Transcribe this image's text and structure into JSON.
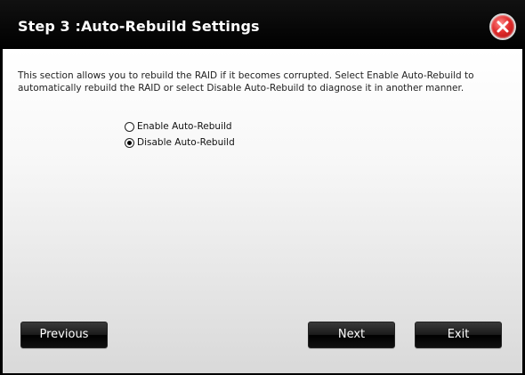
{
  "dialog": {
    "title": "Step 3 :Auto-Rebuild Settings",
    "close_icon": "close-icon"
  },
  "content": {
    "description": "This section allows you to rebuild the RAID if it becomes corrupted. Select Enable Auto-Rebuild to automatically rebuild the RAID or select Disable Auto-Rebuild to diagnose it in another manner."
  },
  "options": [
    {
      "label": "Enable Auto-Rebuild",
      "checked": false
    },
    {
      "label": "Disable Auto-Rebuild",
      "checked": true
    }
  ],
  "buttons": {
    "previous": "Previous",
    "next": "Next",
    "exit": "Exit"
  },
  "colors": {
    "titlebar": "#000000",
    "close_button": "#e02a2a",
    "button_bg": "#1a1a1a",
    "content_bg": "#f0f0f0"
  }
}
